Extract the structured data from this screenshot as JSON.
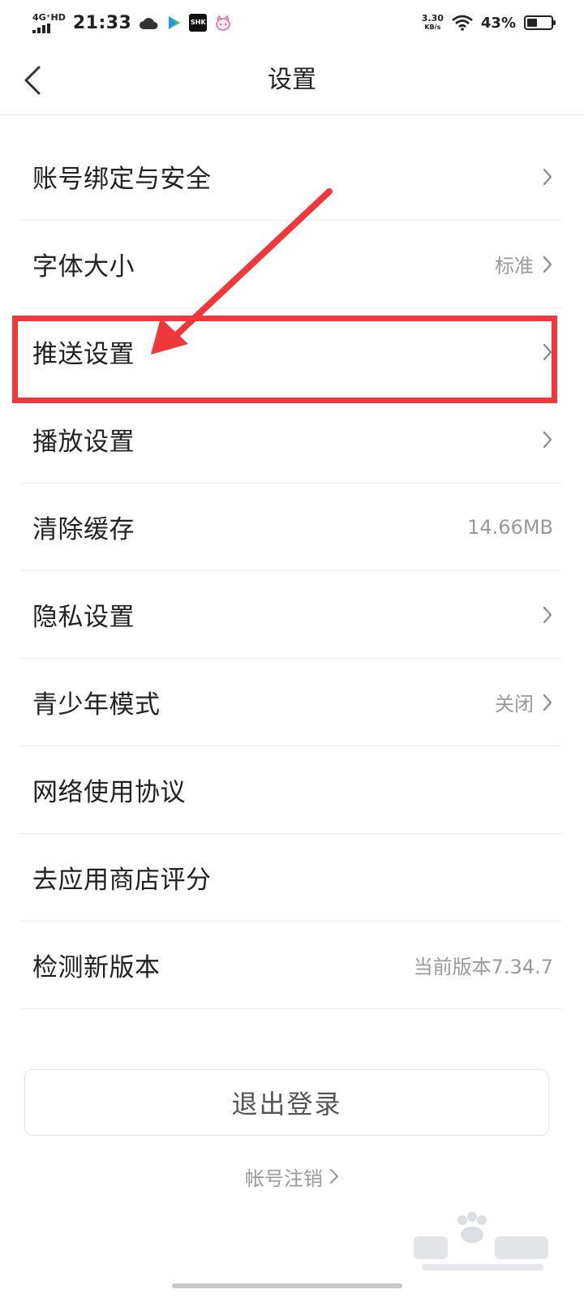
{
  "status_bar": {
    "network": "4G⁺HD",
    "time": "21:33",
    "tag_icon_text": "SHK",
    "speed_value": "3.30",
    "speed_unit": "KB/s",
    "battery_percent": "43%",
    "battery_level": 0.43
  },
  "header": {
    "title": "设置"
  },
  "settings": [
    {
      "label": "账号绑定与安全",
      "value": "",
      "chevron": true
    },
    {
      "label": "字体大小",
      "value": "标准",
      "chevron": true
    },
    {
      "label": "推送设置",
      "value": "",
      "chevron": true
    },
    {
      "label": "播放设置",
      "value": "",
      "chevron": true
    },
    {
      "label": "清除缓存",
      "value": "14.66MB",
      "chevron": false
    },
    {
      "label": "隐私设置",
      "value": "",
      "chevron": true
    },
    {
      "label": "青少年模式",
      "value": "关闭",
      "chevron": true
    },
    {
      "label": "网络使用协议",
      "value": "",
      "chevron": false
    },
    {
      "label": "去应用商店评分",
      "value": "",
      "chevron": false
    },
    {
      "label": "检测新版本",
      "value": "当前版本7.34.7",
      "chevron": false
    }
  ],
  "footer": {
    "logout_label": "退出登录",
    "cancel_account_label": "帐号注销"
  },
  "colors": {
    "annotation": "#f0373a",
    "text_primary": "#222222",
    "text_secondary": "#9a9a9a"
  }
}
